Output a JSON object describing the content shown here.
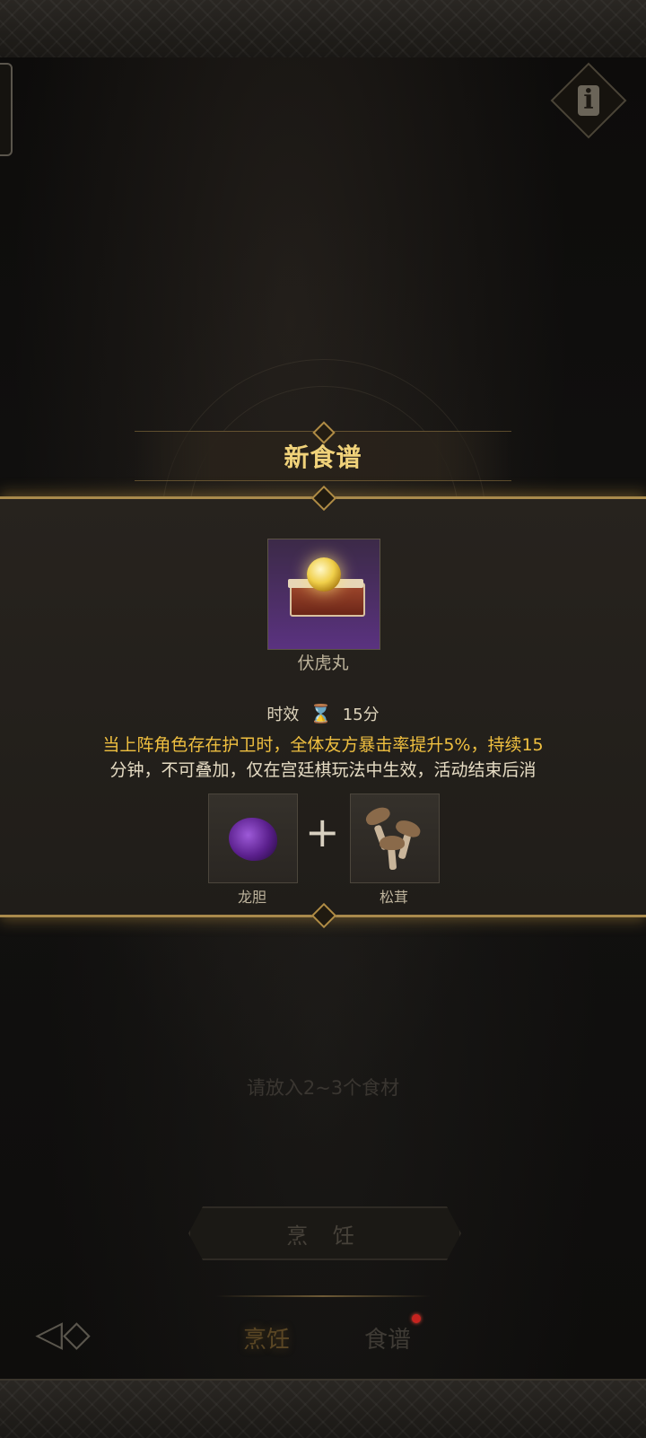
{
  "header": {
    "info_label": "i"
  },
  "popup": {
    "title": "新食谱",
    "result": {
      "name": "伏虎丸",
      "icon": "golden-pill-box-icon"
    },
    "duration": {
      "label": "时效",
      "icon": "hourglass-icon",
      "value": "15分"
    },
    "description": {
      "line1": "当上阵角色存在护卫时，全体友方暴击率提升5%，持续15",
      "line2": "分钟，不可叠加，仅在宫廷棋玩法中生效，活动结束后消"
    },
    "ingredients": [
      {
        "name": "龙胆",
        "icon": "dragon-gall-icon"
      },
      {
        "name": "松茸",
        "icon": "matsutake-icon"
      }
    ],
    "plus": "+"
  },
  "main": {
    "hint": "请放入2~3个食材",
    "cook_button": "烹 饪"
  },
  "tabbar": {
    "back_glyph": "◁◇",
    "tabs": [
      {
        "label": "烹饪",
        "active": true
      },
      {
        "label": "食谱",
        "active": false,
        "badge": true
      }
    ]
  },
  "colors": {
    "accent_gold": "#f0d27a",
    "description_gold": "#f0c040",
    "badge_red": "#c7231f"
  }
}
